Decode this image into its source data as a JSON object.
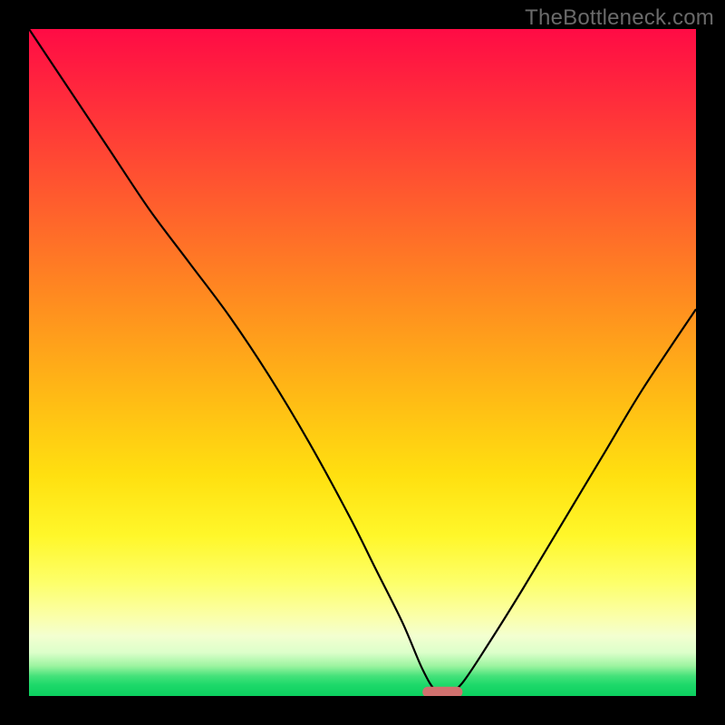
{
  "attribution": "TheBottleneck.com",
  "colors": {
    "background": "#000000",
    "curve_stroke": "#000000",
    "marker_fill": "#d1716f",
    "attribution_text": "#6a6a6a",
    "gradient_top": "#ff0b45",
    "gradient_bottom": "#0bcf5f"
  },
  "chart_data": {
    "type": "line",
    "title": "",
    "xlabel": "",
    "ylabel": "",
    "xlim": [
      0,
      100
    ],
    "ylim": [
      0,
      100
    ],
    "grid": false,
    "legend": false,
    "annotations": {
      "attribution": "TheBottleneck.com"
    },
    "series": [
      {
        "name": "bottleneck-curve",
        "x": [
          0,
          6,
          12,
          18,
          24,
          30,
          36,
          42,
          48,
          52,
          56,
          59,
          61,
          63,
          65,
          69,
          74,
          80,
          86,
          92,
          100
        ],
        "values": [
          100,
          91,
          82,
          73,
          65,
          57,
          48,
          38,
          27,
          19,
          11,
          4,
          0.8,
          0.6,
          2,
          8,
          16,
          26,
          36,
          46,
          58
        ]
      }
    ],
    "marker": {
      "x_center": 62,
      "y": 0.6,
      "width": 6,
      "height": 1.6,
      "shape": "rounded-bar"
    }
  }
}
